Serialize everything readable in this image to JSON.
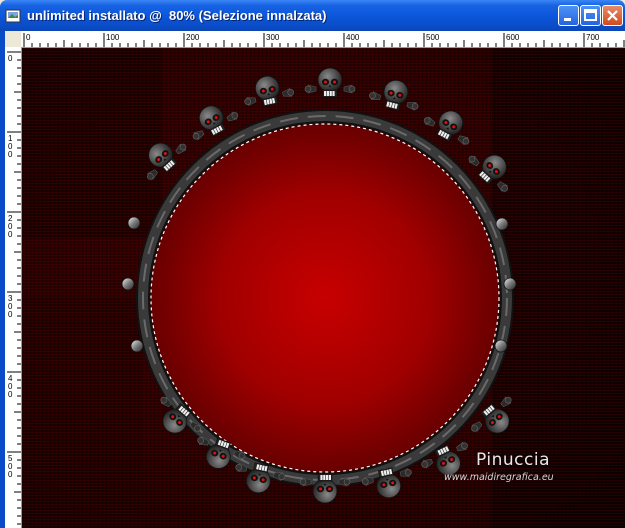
{
  "window": {
    "title": "unlimited installato @  80% (Selezione innalzata)"
  },
  "ruler": {
    "h_labels": [
      "0",
      "100",
      "200",
      "300",
      "400",
      "500",
      "600",
      "700"
    ],
    "v_labels": [
      "0",
      "100",
      "200",
      "300",
      "400",
      "500"
    ]
  },
  "watermark": {
    "name": "Pinuccia",
    "url": "www.maidiregrafica.eu"
  },
  "colors": {
    "titlebar": "#0a4cc7",
    "canvas_bg": "#2a0000",
    "circle_center": "#c40000",
    "circle_edge": "#5c0000",
    "frame": "#2b2b2b"
  }
}
